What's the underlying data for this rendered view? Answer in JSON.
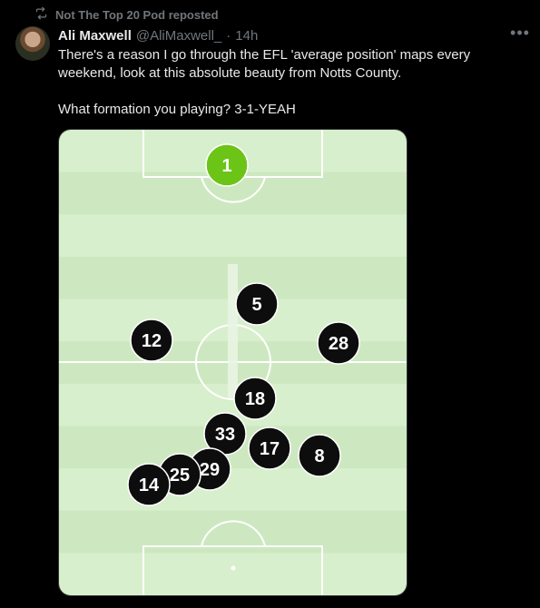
{
  "repost": {
    "icon": "repost-icon",
    "label": "Not The Top 20 Pod reposted"
  },
  "author": {
    "name": "Ali Maxwell",
    "handle": "@AliMaxwell_",
    "separator": "·",
    "time": "14h",
    "avatar": "avatar-photo"
  },
  "tweet": {
    "paragraphs": [
      "There's a reason I go through the EFL 'average position' maps every weekend, look at this absolute beauty from Notts County.",
      "What formation you playing? 3-1-YEAH"
    ]
  },
  "more_icon": "more-horizontal-icon",
  "pitch_map": {
    "colors": {
      "stripe_light": "#d7efcc",
      "stripe_dark": "#cde8c0",
      "lines": "#ffffff",
      "goalkeeper": "#6cc417",
      "outfield": "#0d0d0d",
      "number_text": "#ffffff"
    },
    "players": [
      {
        "number": "1",
        "role": "goalkeeper"
      },
      {
        "number": "5",
        "role": "outfield"
      },
      {
        "number": "12",
        "role": "outfield"
      },
      {
        "number": "28",
        "role": "outfield"
      },
      {
        "number": "18",
        "role": "outfield"
      },
      {
        "number": "33",
        "role": "outfield"
      },
      {
        "number": "17",
        "role": "outfield"
      },
      {
        "number": "8",
        "role": "outfield"
      },
      {
        "number": "29",
        "role": "outfield"
      },
      {
        "number": "25",
        "role": "outfield"
      },
      {
        "number": "14",
        "role": "outfield"
      }
    ]
  }
}
